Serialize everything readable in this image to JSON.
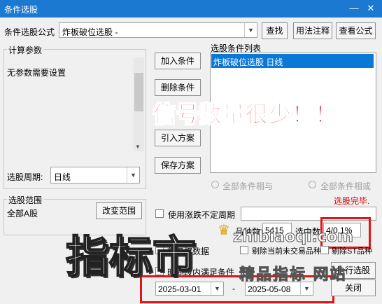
{
  "window": {
    "title": "条件选股",
    "min_glyph": "—",
    "close_glyph": "✕"
  },
  "formula": {
    "label": "条件选股公式",
    "value": "炸板破位选股 -",
    "find": "查找",
    "usage": "用法注释",
    "view": "查看公式"
  },
  "params": {
    "group": "计算参数",
    "none": "无参数需要设置",
    "period_label": "选股周期:",
    "period_value": "日线"
  },
  "actions": {
    "add": "加入条件",
    "remove": "删除条件",
    "import": "引入方案",
    "save": "保存方案"
  },
  "conditions": {
    "group": "选股条件列表",
    "items": [
      "炸板破位选股  日线"
    ]
  },
  "logic": {
    "and": "全部条件相与",
    "or": "全部条件相或"
  },
  "status": "选股完毕.",
  "range": {
    "group": "选股范围",
    "value": "全部A股",
    "change": "改变范围"
  },
  "options": {
    "variable_period": "使用涨跌不定周期",
    "total_label": "品种数",
    "total": "5415",
    "selected_label": "选中数",
    "selected": "4/0.1%",
    "rights_partial": "前复权数据",
    "exclude_partial": "剔除当前未交易品种",
    "exclude_st_partial": "剔除ST品种",
    "time_partial": "时间段内满足条件",
    "start_date": "2025-03-01",
    "end_date": "2025-05-08",
    "dash": "-",
    "execute_partial": "执行选股",
    "close": "关闭"
  },
  "annotations": {
    "headline": "信号数量很少！！",
    "watermark_big": "指标市",
    "watermark_site": "zhibiaoqi.com",
    "watermark_sub": "精品指标 网站"
  },
  "colors": {
    "title_bg": "#1b79d2",
    "selection": "#0a78d7",
    "alert": "#e00000"
  }
}
